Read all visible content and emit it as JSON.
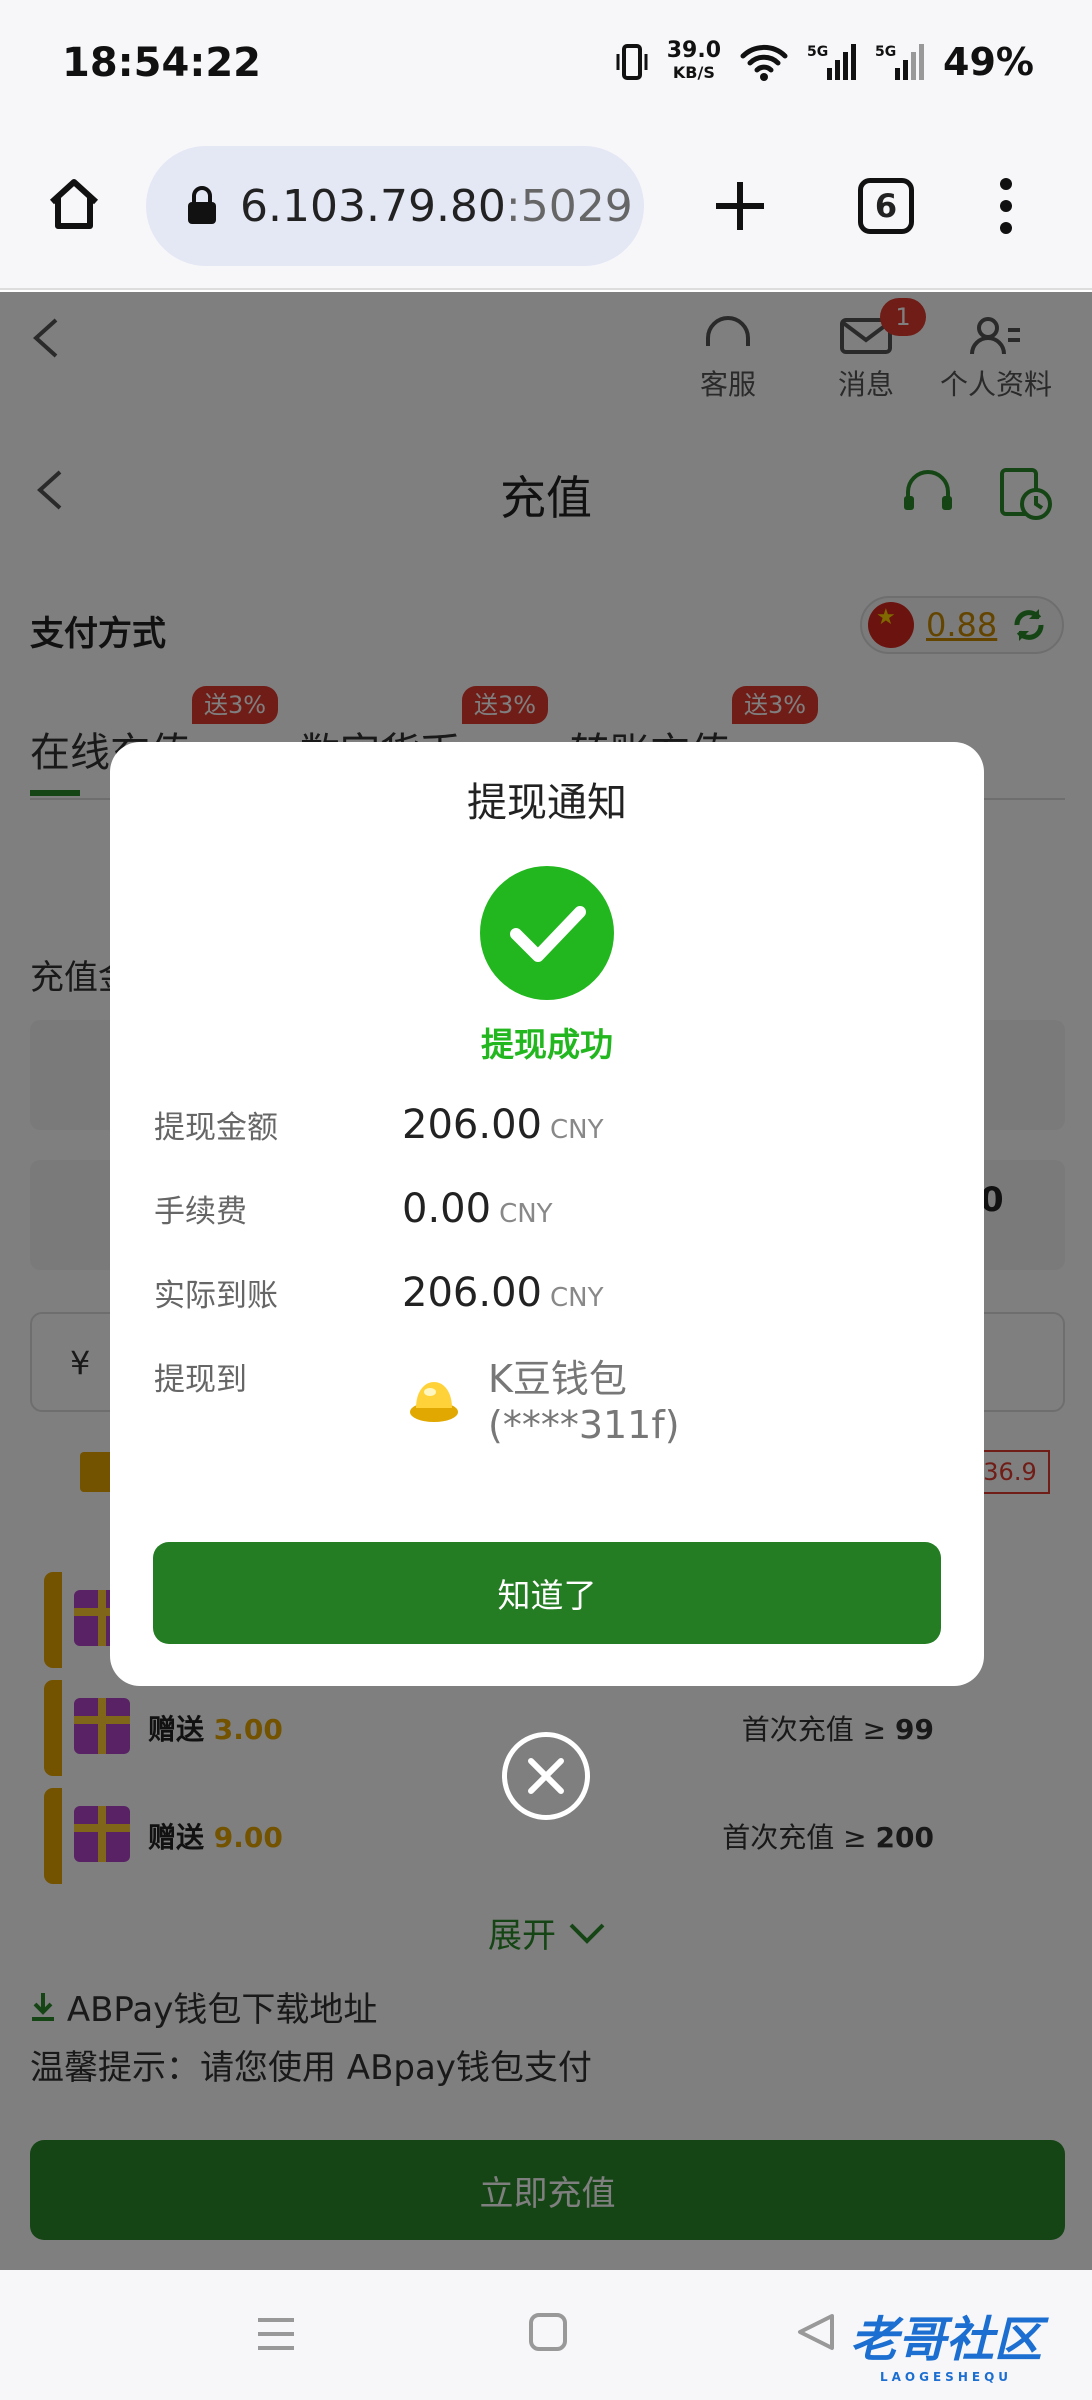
{
  "status_bar": {
    "time": "18:54:22",
    "speed_value": "39.0",
    "speed_unit": "KB/S",
    "sim1": "5G",
    "sim2": "5G",
    "battery": "49%"
  },
  "browser": {
    "url_main": "6.103.79.80",
    "url_port": ":5029",
    "tab_count": "6"
  },
  "app_header": {
    "nav_items": [
      {
        "label": "客服",
        "icon": "headset-icon"
      },
      {
        "label": "消息",
        "icon": "mail-icon",
        "badge": "1"
      },
      {
        "label": "个人资料",
        "icon": "profile-icon"
      }
    ]
  },
  "recharge_sheet": {
    "title": "充值",
    "payment_method_label": "支付方式",
    "balance": "0.88",
    "tabs": [
      {
        "label": "在线充值",
        "badge": "送3%"
      },
      {
        "label": "数字货币",
        "badge": "送3%"
      },
      {
        "label": "转账充值",
        "badge": "送3%"
      }
    ],
    "amount_label": "充值金额",
    "partial_right_value": "0",
    "currency_symbol": "¥",
    "countdown_partial": "36.9",
    "promotions": [
      {
        "label": "赠送",
        "amount": "3.00",
        "cond_label": "首次充值 ≥",
        "cond_value": "99"
      },
      {
        "label": "赠送",
        "amount": "9.00",
        "cond_label": "首次充值 ≥",
        "cond_value": "200"
      }
    ],
    "expand_label": "展开",
    "download_link": "ABPay钱包下载地址",
    "tip": "温馨提示：请您使用 ABpay钱包支付",
    "submit_button": "立即充值"
  },
  "dialog": {
    "title": "提现通知",
    "success_text": "提现成功",
    "rows": [
      {
        "label": "提现金额",
        "value": "206.00",
        "currency": "CNY"
      },
      {
        "label": "手续费",
        "value": "0.00",
        "currency": "CNY"
      },
      {
        "label": "实际到账",
        "value": "206.00",
        "currency": "CNY"
      }
    ],
    "destination_label": "提现到",
    "wallet_name": "K豆钱包",
    "wallet_account": "(****311f)",
    "ok_button": "知道了"
  },
  "watermark": {
    "text": "老哥社区",
    "sub": "LAOGESHEQU"
  },
  "colors": {
    "success_green": "#22b71e",
    "button_green": "#247d23",
    "badge_red": "#e03a2f",
    "gold": "#e7a500"
  }
}
